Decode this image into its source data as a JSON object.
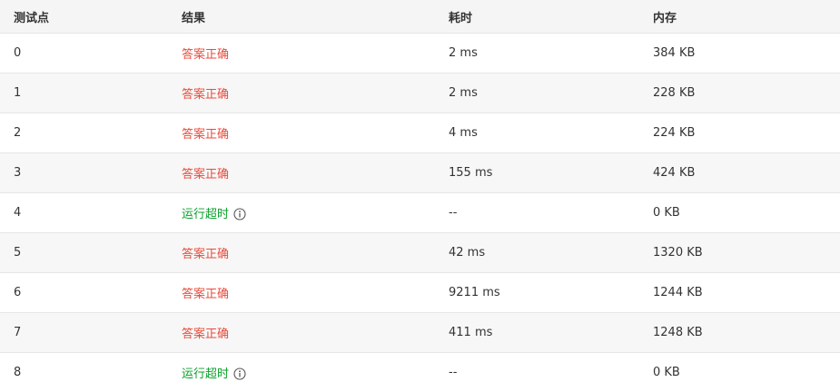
{
  "colors": {
    "accepted": "#e74c3c",
    "time_limit_exceeded": "#0a9f2a",
    "header_bg": "#f5f5f5",
    "stripe_bg": "#f7f7f7"
  },
  "table": {
    "headers": {
      "testcase": "测试点",
      "result": "结果",
      "time": "耗时",
      "memory": "内存"
    },
    "rows": [
      {
        "id": "0",
        "result": "答案正确",
        "status": "ok",
        "time": "2 ms",
        "memory": "384 KB",
        "icon": ""
      },
      {
        "id": "1",
        "result": "答案正确",
        "status": "ok",
        "time": "2 ms",
        "memory": "228 KB",
        "icon": ""
      },
      {
        "id": "2",
        "result": "答案正确",
        "status": "ok",
        "time": "4 ms",
        "memory": "224 KB",
        "icon": ""
      },
      {
        "id": "3",
        "result": "答案正确",
        "status": "ok",
        "time": "155 ms",
        "memory": "424 KB",
        "icon": ""
      },
      {
        "id": "4",
        "result": "运行超时",
        "status": "tle",
        "time": "--",
        "memory": "0 KB",
        "icon": "info-icon"
      },
      {
        "id": "5",
        "result": "答案正确",
        "status": "ok",
        "time": "42 ms",
        "memory": "1320 KB",
        "icon": ""
      },
      {
        "id": "6",
        "result": "答案正确",
        "status": "ok",
        "time": "9211 ms",
        "memory": "1244 KB",
        "icon": ""
      },
      {
        "id": "7",
        "result": "答案正确",
        "status": "ok",
        "time": "411 ms",
        "memory": "1248 KB",
        "icon": ""
      },
      {
        "id": "8",
        "result": "运行超时",
        "status": "tle",
        "time": "--",
        "memory": "0 KB",
        "icon": "info-icon"
      }
    ]
  }
}
